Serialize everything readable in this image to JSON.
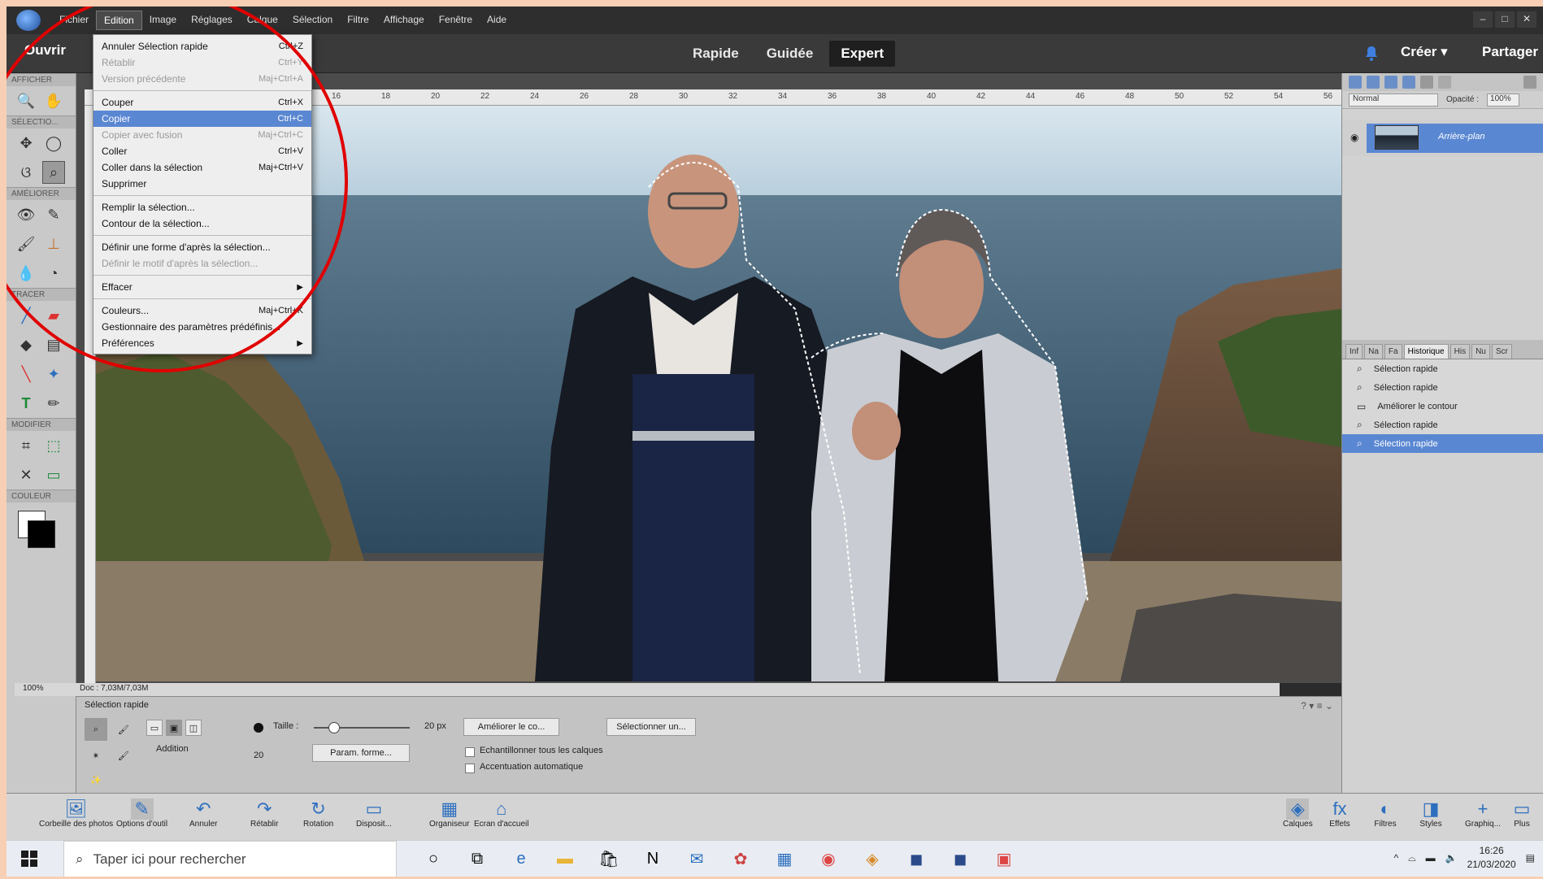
{
  "menubar": {
    "items": [
      "Fichier",
      "Edition",
      "Image",
      "Réglages",
      "Calque",
      "Sélection",
      "Filtre",
      "Affichage",
      "Fenêtre",
      "Aide"
    ],
    "active": "Edition",
    "win_min": "–",
    "win_max": "□",
    "win_close": "✕"
  },
  "topbar": {
    "open_label": "Ouvrir",
    "modes": [
      "Rapide",
      "Guidée",
      "Expert"
    ],
    "active_mode": "Expert",
    "create_label": "Créer ▾",
    "share_label": "Partager"
  },
  "toolbox": {
    "sections": [
      "AFFICHER",
      "SÉLECTIO...",
      "AMÉLIORER",
      "TRACER",
      "MODIFIER",
      "COULEUR"
    ]
  },
  "ruler": {
    "ticks": [
      "16",
      "18",
      "20",
      "22",
      "24",
      "26",
      "28",
      "30",
      "32",
      "34",
      "36",
      "38",
      "40",
      "42",
      "44",
      "46",
      "48",
      "50",
      "52",
      "54",
      "56"
    ]
  },
  "status": {
    "zoom": "100%",
    "doc": "Doc : 7,03M/7,03M"
  },
  "layers": {
    "blend_mode": "Normal",
    "opacity_label": "Opacité :",
    "opacity_value": "100%",
    "layer_name": "Arrière-plan"
  },
  "panel_tabs": [
    "Inf",
    "Na",
    "Fa",
    "Historique",
    "His",
    "Nu",
    "Scr"
  ],
  "panel_tabs_active": "Historique",
  "history": [
    "Sélection rapide",
    "Sélection rapide",
    "Améliorer le contour",
    "Sélection rapide",
    "Sélection rapide"
  ],
  "options": {
    "title": "Sélection rapide",
    "mode_label": "Addition",
    "size_label": "Taille :",
    "size_value": "20 px",
    "size_small": "20",
    "brush_btn": "Param. forme...",
    "refine_btn": "Améliorer le co...",
    "sample_all": "Echantillonner tous les calques",
    "auto_enhance": "Accentuation automatique",
    "select_btn": "Sélectionner un...",
    "help": "? ▾ ≡ ⌄"
  },
  "bottombar": {
    "items": [
      "Corbeille des photos",
      "Options d'outil",
      "Annuler",
      "Rétablir",
      "Rotation",
      "Disposit...",
      "Organiseur",
      "Ecran d'accueil"
    ],
    "right_items": [
      "Calques",
      "Effets",
      "Filtres",
      "Styles",
      "Graphiq...",
      "Plus"
    ]
  },
  "taskbar": {
    "search_placeholder": "Taper ici pour rechercher",
    "time": "16:26",
    "date": "21/03/2020"
  },
  "dropdown": {
    "groups": [
      [
        {
          "label": "Annuler Sélection rapide",
          "shortcut": "Ctrl+Z",
          "disabled": false
        },
        {
          "label": "Rétablir",
          "shortcut": "Ctrl+Y",
          "disabled": true
        },
        {
          "label": "Version précédente",
          "shortcut": "Maj+Ctrl+A",
          "disabled": true
        }
      ],
      [
        {
          "label": "Couper",
          "shortcut": "Ctrl+X",
          "disabled": false
        },
        {
          "label": "Copier",
          "shortcut": "Ctrl+C",
          "disabled": false,
          "highlight": true
        },
        {
          "label": "Copier avec fusion",
          "shortcut": "Maj+Ctrl+C",
          "disabled": true
        },
        {
          "label": "Coller",
          "shortcut": "Ctrl+V",
          "disabled": false
        },
        {
          "label": "Coller dans la sélection",
          "shortcut": "Maj+Ctrl+V",
          "disabled": false
        },
        {
          "label": "Supprimer",
          "shortcut": "",
          "disabled": false
        }
      ],
      [
        {
          "label": "Remplir la sélection...",
          "shortcut": "",
          "disabled": false
        },
        {
          "label": "Contour de la sélection...",
          "shortcut": "",
          "disabled": false
        }
      ],
      [
        {
          "label": "Définir une forme d'après la sélection...",
          "shortcut": "",
          "disabled": false
        },
        {
          "label": "Définir le motif d'après la sélection...",
          "shortcut": "",
          "disabled": true
        }
      ],
      [
        {
          "label": "Effacer",
          "shortcut": "",
          "disabled": false,
          "submenu": true
        }
      ],
      [
        {
          "label": "Couleurs...",
          "shortcut": "Maj+Ctrl+K",
          "disabled": false
        },
        {
          "label": "Gestionnaire des paramètres prédéfinis...",
          "shortcut": "",
          "disabled": false
        },
        {
          "label": "Préférences",
          "shortcut": "",
          "disabled": false,
          "submenu": true
        }
      ]
    ]
  },
  "colors": {
    "accent": "#5a87d2",
    "annotation": "#e00000"
  }
}
